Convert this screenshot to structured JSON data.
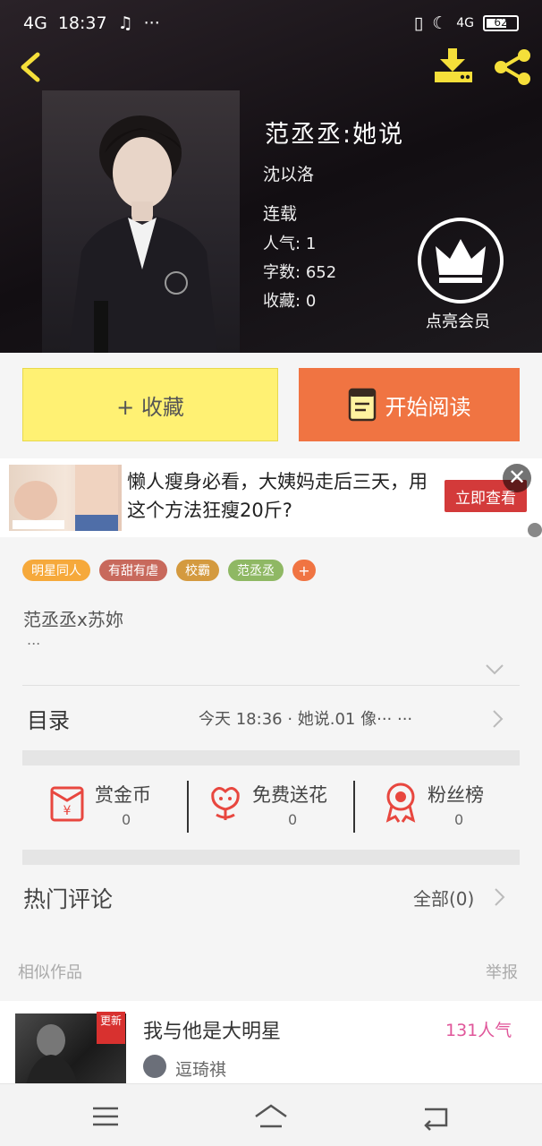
{
  "status_bar": {
    "network": "4G",
    "time": "18:37",
    "more": "···",
    "network2": "4G",
    "battery": "62"
  },
  "book": {
    "title": "范丞丞:她说",
    "author": "沈以洛",
    "status": "连载",
    "popularity_label": "人气:",
    "popularity": "1",
    "wordcount_label": "字数:",
    "wordcount": "652",
    "favorites_label": "收藏:",
    "favorites": "0",
    "vip_label": "点亮会员"
  },
  "buttons": {
    "collect": "+ 收藏",
    "read": "开始阅读"
  },
  "ad": {
    "text": "懒人瘦身必看，大姨妈走后三天，用这个方法狂瘦20斤?",
    "cta": "立即查看",
    "close": "✕"
  },
  "tags": [
    {
      "label": "明星同人",
      "color": "#f6a93b"
    },
    {
      "label": "有甜有虐",
      "color": "#c8695c"
    },
    {
      "label": "校霸",
      "color": "#d49a3f"
    },
    {
      "label": "范丞丞",
      "color": "#8fb864"
    }
  ],
  "tag_add": "+",
  "intro": {
    "text": "范丞丞x苏妳",
    "more": "..."
  },
  "toc": {
    "label": "目录",
    "latest": "今天 18:36 · 她说.01 像··· ···"
  },
  "actions": [
    {
      "label": "赏金币",
      "count": "0",
      "icon": "red-envelope-icon",
      "color": "#e8473f"
    },
    {
      "label": "免费送花",
      "count": "0",
      "icon": "flower-icon",
      "color": "#e8473f"
    },
    {
      "label": "粉丝榜",
      "count": "0",
      "icon": "medal-icon",
      "color": "#e8473f"
    }
  ],
  "comments": {
    "label": "热门评论",
    "all": "全部(0)"
  },
  "similar": {
    "label": "相似作品",
    "report": "举报",
    "items": [
      {
        "title": "我与他是大明星",
        "popularity": "131人气",
        "author": "逗琦祺",
        "badge": "更新"
      }
    ]
  },
  "colors": {
    "accent_orange": "#f07442",
    "collect_yellow": "#fff173",
    "vip_white": "#ffffff",
    "popularity_pink": "#e0569a"
  }
}
